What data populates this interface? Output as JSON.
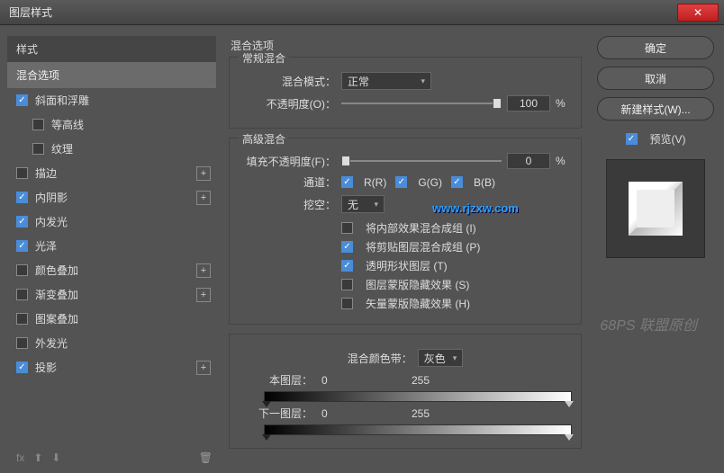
{
  "window": {
    "title": "图层样式"
  },
  "left": {
    "header": "样式",
    "selected": "混合选项",
    "items": [
      {
        "label": "斜面和浮雕",
        "checked": true,
        "plus": false,
        "indent": 0
      },
      {
        "label": "等高线",
        "checked": false,
        "plus": false,
        "indent": 1
      },
      {
        "label": "纹理",
        "checked": false,
        "plus": false,
        "indent": 1
      },
      {
        "label": "描边",
        "checked": false,
        "plus": true,
        "indent": 0
      },
      {
        "label": "内阴影",
        "checked": true,
        "plus": true,
        "indent": 0
      },
      {
        "label": "内发光",
        "checked": true,
        "plus": false,
        "indent": 0
      },
      {
        "label": "光泽",
        "checked": true,
        "plus": false,
        "indent": 0
      },
      {
        "label": "颜色叠加",
        "checked": false,
        "plus": true,
        "indent": 0
      },
      {
        "label": "渐变叠加",
        "checked": false,
        "plus": true,
        "indent": 0
      },
      {
        "label": "图案叠加",
        "checked": false,
        "plus": false,
        "indent": 0
      },
      {
        "label": "外发光",
        "checked": false,
        "plus": false,
        "indent": 0
      },
      {
        "label": "投影",
        "checked": true,
        "plus": true,
        "indent": 0
      }
    ],
    "footer_fx": "fx"
  },
  "mid": {
    "title": "混合选项",
    "normal_blend": {
      "legend": "常规混合",
      "blend_mode_label": "混合模式：",
      "blend_mode_value": "正常",
      "opacity_label": "不透明度(O)：",
      "opacity_value": "100",
      "opacity_unit": "%"
    },
    "adv_blend": {
      "legend": "高级混合",
      "fill_label": "填充不透明度(F)：",
      "fill_value": "0",
      "fill_unit": "%",
      "channel_label": "通道：",
      "channels": [
        {
          "label": "R(R)",
          "checked": true
        },
        {
          "label": "G(G)",
          "checked": true
        },
        {
          "label": "B(B)",
          "checked": true
        }
      ],
      "knockout_label": "挖空：",
      "knockout_value": "无",
      "options": [
        {
          "label": "将内部效果混合成组 (I)",
          "checked": false
        },
        {
          "label": "将剪贴图层混合成组 (P)",
          "checked": true
        },
        {
          "label": "透明形状图层 (T)",
          "checked": true
        },
        {
          "label": "图层蒙版隐藏效果 (S)",
          "checked": false
        },
        {
          "label": "矢量蒙版隐藏效果 (H)",
          "checked": false
        }
      ]
    },
    "blend_if": {
      "label": "混合颜色带：",
      "value": "灰色",
      "this_layer_label": "本图层：",
      "this_low": "0",
      "this_high": "255",
      "under_layer_label": "下一图层：",
      "under_low": "0",
      "under_high": "255"
    }
  },
  "right": {
    "ok": "确定",
    "cancel": "取消",
    "new_style": "新建样式(W)...",
    "preview": "预览(V)"
  },
  "watermark": "www.rjzxw.com",
  "watermark2": "68PS 联盟原创"
}
